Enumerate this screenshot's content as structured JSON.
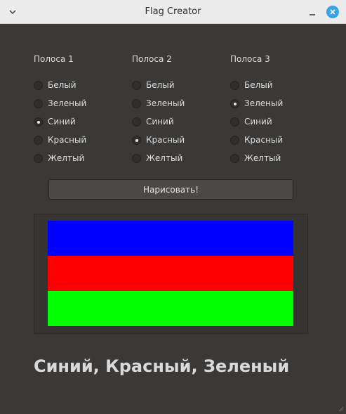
{
  "window": {
    "title": "Flag Creator"
  },
  "columns": [
    {
      "title": "Полоса 1",
      "options": [
        {
          "label": "Белый",
          "checked": false
        },
        {
          "label": "Зеленый",
          "checked": false
        },
        {
          "label": "Синий",
          "checked": true
        },
        {
          "label": "Красный",
          "checked": false
        },
        {
          "label": "Желтый",
          "checked": false
        }
      ]
    },
    {
      "title": "Полоса 2",
      "options": [
        {
          "label": "Белый",
          "checked": false
        },
        {
          "label": "Зеленый",
          "checked": false
        },
        {
          "label": "Синий",
          "checked": false
        },
        {
          "label": "Красный",
          "checked": true
        },
        {
          "label": "Желтый",
          "checked": false
        }
      ]
    },
    {
      "title": "Полоса 3",
      "options": [
        {
          "label": "Белый",
          "checked": false
        },
        {
          "label": "Зеленый",
          "checked": true
        },
        {
          "label": "Синий",
          "checked": false
        },
        {
          "label": "Красный",
          "checked": false
        },
        {
          "label": "Желтый",
          "checked": false
        }
      ]
    }
  ],
  "draw_button": {
    "label": "Нарисовать!"
  },
  "flag": {
    "stripe_colors": [
      "#0000ff",
      "#ff0000",
      "#00ff00"
    ]
  },
  "result_text": "Синий, Красный, Зеленый"
}
